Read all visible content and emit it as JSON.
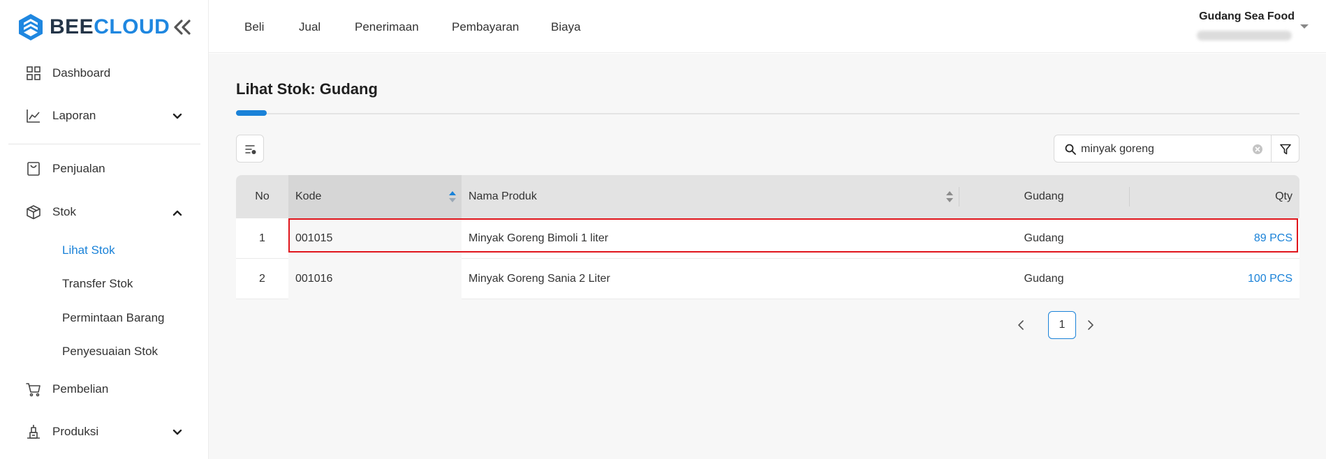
{
  "brand": {
    "part1": "BEE",
    "part2": "CLOUD",
    "accent": "#1f87e0",
    "dark": "#243548"
  },
  "sidebar": {
    "items": [
      {
        "label": "Dashboard",
        "icon": "grid-icon"
      },
      {
        "label": "Laporan",
        "icon": "line-chart-icon"
      },
      {
        "label": "Penjualan",
        "icon": "bag-icon"
      },
      {
        "label": "Stok",
        "icon": "box-icon"
      },
      {
        "label": "Pembelian",
        "icon": "cart-icon"
      },
      {
        "label": "Produksi",
        "icon": "factory-icon"
      }
    ],
    "stok_sub": [
      {
        "label": "Lihat Stok",
        "active": true
      },
      {
        "label": "Transfer Stok",
        "active": false
      },
      {
        "label": "Permintaan Barang",
        "active": false
      },
      {
        "label": "Penyesuaian Stok",
        "active": false
      }
    ]
  },
  "topnav": [
    "Beli",
    "Jual",
    "Penerimaan",
    "Pembayaran",
    "Biaya"
  ],
  "account": {
    "name": "Gudang Sea Food"
  },
  "page": {
    "title": "Lihat Stok: Gudang"
  },
  "search": {
    "value": "minyak goreng"
  },
  "table": {
    "columns": [
      "No",
      "Kode",
      "Nama Produk",
      "Gudang",
      "Qty"
    ],
    "rows": [
      {
        "no": "1",
        "kode": "001015",
        "nama": "Minyak Goreng Bimoli 1 liter",
        "gudang": "Gudang",
        "qty": "89 PCS"
      },
      {
        "no": "2",
        "kode": "001016",
        "nama": "Minyak Goreng Sania 2 Liter",
        "gudang": "Gudang",
        "qty": "100 PCS"
      }
    ]
  },
  "pagination": {
    "current": "1"
  }
}
